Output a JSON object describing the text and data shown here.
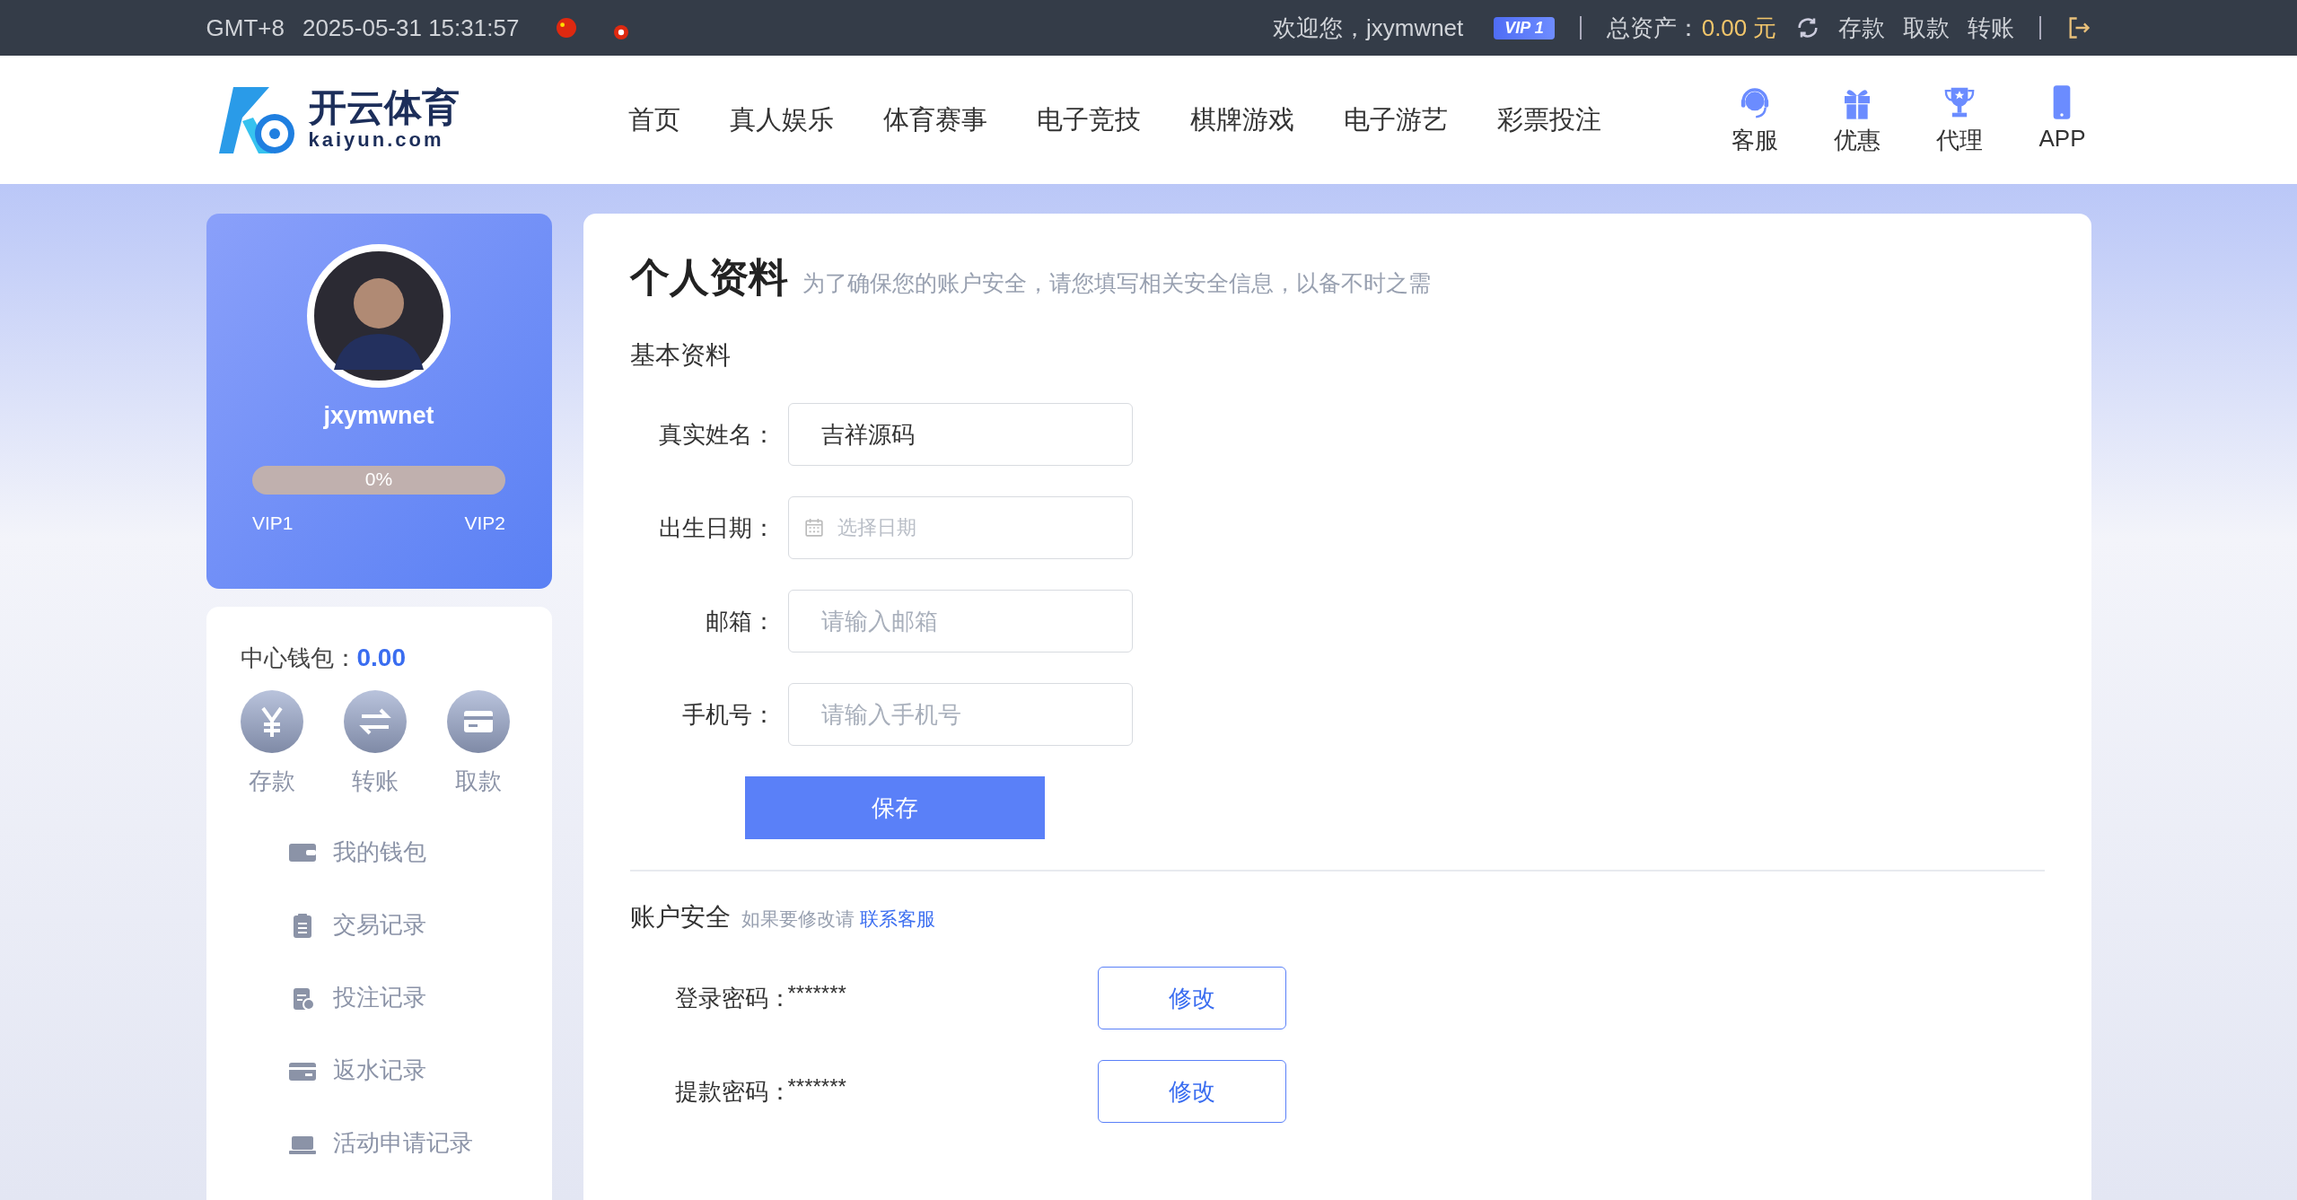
{
  "top_bar": {
    "timezone": "GMT+8",
    "datetime": "2025-05-31 15:31:57",
    "welcome": "欢迎您，jxymwnet",
    "vip_badge": "VIP 1",
    "assets_label": "总资产：",
    "assets_value": "0.00 元",
    "links": [
      "存款",
      "取款",
      "转账"
    ]
  },
  "header": {
    "logo": {
      "title": "开云体育",
      "domain": "kaiyun.com"
    },
    "nav": [
      "首页",
      "真人娱乐",
      "体育赛事",
      "电子竞技",
      "棋牌游戏",
      "电子游艺",
      "彩票投注"
    ],
    "quick_links": [
      {
        "label": "客服",
        "kind": "headset"
      },
      {
        "label": "优惠",
        "kind": "gift"
      },
      {
        "label": "代理",
        "kind": "trophy"
      },
      {
        "label": "APP",
        "kind": "phone"
      }
    ]
  },
  "profile": {
    "username": "jxymwnet",
    "progress": {
      "level": 0,
      "label": "0%"
    },
    "vip_from": "VIP1",
    "vip_to": "VIP2"
  },
  "wallet": {
    "label": "中心钱包：",
    "balance": "0.00",
    "actions": [
      {
        "label": "存款",
        "kind": "yen"
      },
      {
        "label": "转账",
        "kind": "transfer"
      },
      {
        "label": "取款",
        "kind": "card"
      }
    ],
    "menu": [
      {
        "label": "我的钱包",
        "kind": "wallet"
      },
      {
        "label": "交易记录",
        "kind": "clipboard"
      },
      {
        "label": "投注记录",
        "kind": "bet"
      },
      {
        "label": "返水记录",
        "kind": "card"
      },
      {
        "label": "活动申请记录",
        "kind": "laptop"
      }
    ]
  },
  "main": {
    "title": "个人资料",
    "subtitle": "为了确保您的账户安全，请您填写相关安全信息，以备不时之需",
    "section": "基本资料",
    "fields": [
      {
        "label": "真实姓名：",
        "kind": "text",
        "value": "吉祥源码"
      },
      {
        "label": "出生日期：",
        "kind": "date",
        "placeholder": "选择日期"
      },
      {
        "label": "邮箱：",
        "kind": "text",
        "placeholder": "请输入邮箱"
      },
      {
        "label": "手机号：",
        "kind": "text",
        "placeholder": "请输入手机号"
      }
    ],
    "save_button": "保存",
    "security": {
      "title": "账户安全",
      "note": "如果要修改请",
      "link": "联系客服",
      "rows": [
        {
          "label": "登录密码：",
          "value": "*******",
          "button": "修改"
        },
        {
          "label": "提款密码：",
          "value": "*******",
          "button": "修改"
        }
      ]
    }
  }
}
